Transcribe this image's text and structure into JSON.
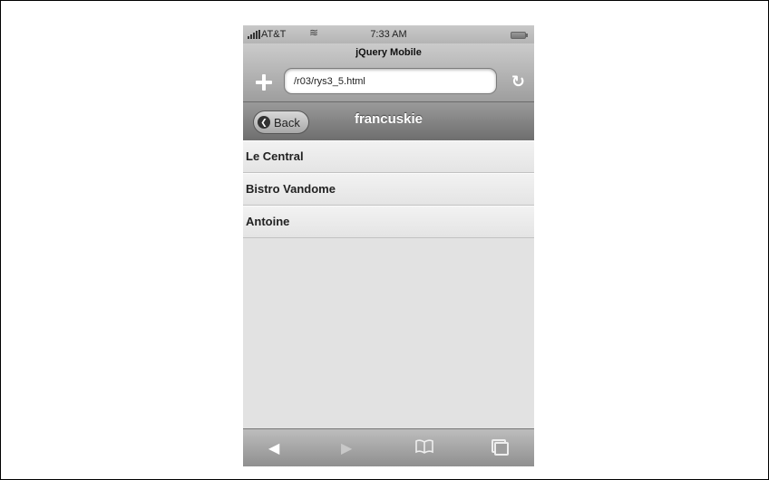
{
  "status_bar": {
    "carrier": "AT&T",
    "time": "7:33 AM",
    "wifi_icon": "wifi-icon",
    "battery_icon": "battery-icon"
  },
  "browser": {
    "page_title": "jQuery Mobile",
    "url": "/r03/rys3_5.html",
    "add_icon": "plus-icon",
    "reload_icon": "reload-icon"
  },
  "header": {
    "back_label": "Back",
    "title": "francuskie"
  },
  "list": {
    "items": [
      "Le Central",
      "Bistro Vandome",
      "Antoine"
    ]
  },
  "toolbar": {
    "back_glyph": "◀",
    "forward_glyph": "▶",
    "bookmarks_glyph": "📖",
    "icons": [
      "back-arrow-icon",
      "forward-arrow-icon",
      "bookmarks-icon",
      "pages-icon"
    ]
  }
}
